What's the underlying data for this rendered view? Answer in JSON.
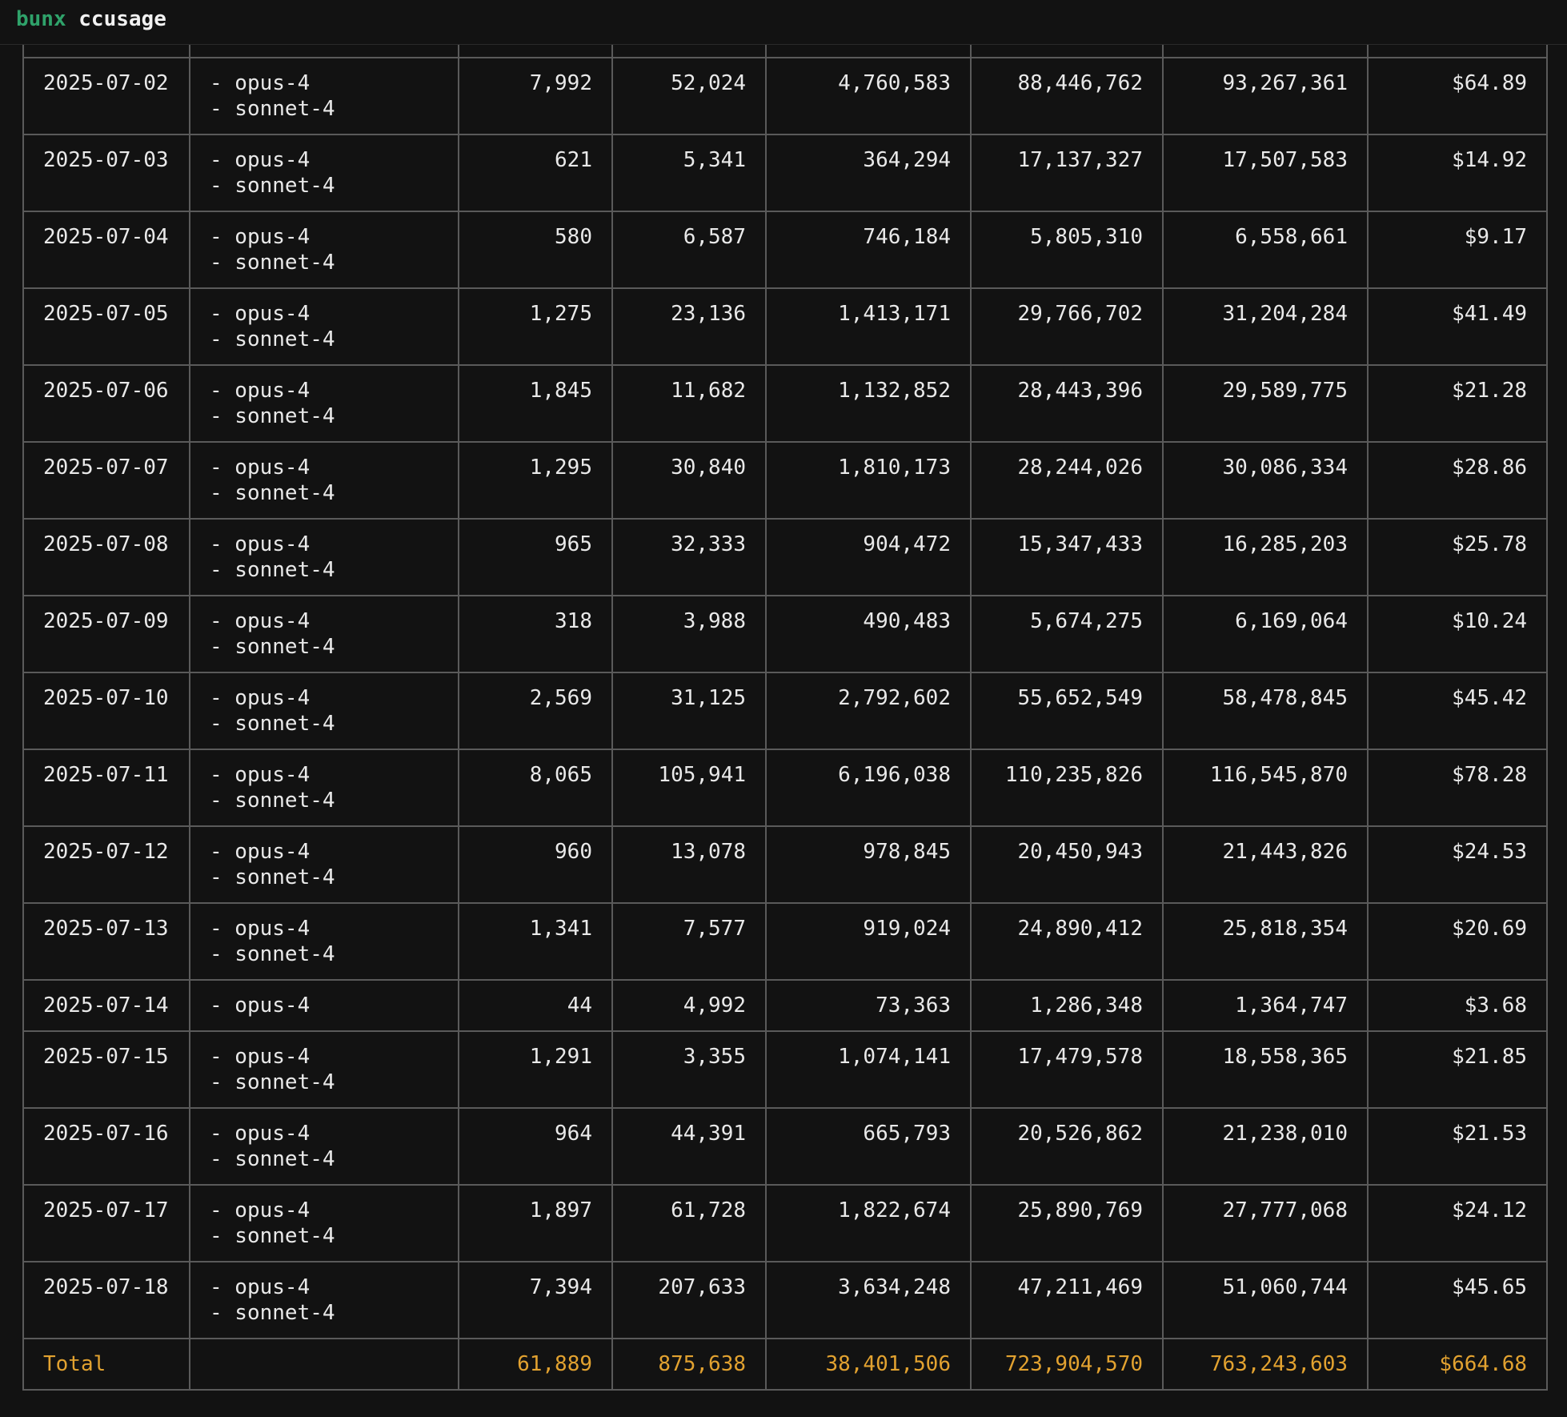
{
  "terminal": {
    "command_bin": "bunx",
    "command_arg": "ccusage"
  },
  "rows": [
    {
      "date": "2025-07-02",
      "models": [
        "- opus-4",
        "- sonnet-4"
      ],
      "input": "7,992",
      "output": "52,024",
      "cache_create": "4,760,583",
      "cache_read": "88,446,762",
      "total_tokens": "93,267,361",
      "cost": "$64.89"
    },
    {
      "date": "2025-07-03",
      "models": [
        "- opus-4",
        "- sonnet-4"
      ],
      "input": "621",
      "output": "5,341",
      "cache_create": "364,294",
      "cache_read": "17,137,327",
      "total_tokens": "17,507,583",
      "cost": "$14.92"
    },
    {
      "date": "2025-07-04",
      "models": [
        "- opus-4",
        "- sonnet-4"
      ],
      "input": "580",
      "output": "6,587",
      "cache_create": "746,184",
      "cache_read": "5,805,310",
      "total_tokens": "6,558,661",
      "cost": "$9.17"
    },
    {
      "date": "2025-07-05",
      "models": [
        "- opus-4",
        "- sonnet-4"
      ],
      "input": "1,275",
      "output": "23,136",
      "cache_create": "1,413,171",
      "cache_read": "29,766,702",
      "total_tokens": "31,204,284",
      "cost": "$41.49"
    },
    {
      "date": "2025-07-06",
      "models": [
        "- opus-4",
        "- sonnet-4"
      ],
      "input": "1,845",
      "output": "11,682",
      "cache_create": "1,132,852",
      "cache_read": "28,443,396",
      "total_tokens": "29,589,775",
      "cost": "$21.28"
    },
    {
      "date": "2025-07-07",
      "models": [
        "- opus-4",
        "- sonnet-4"
      ],
      "input": "1,295",
      "output": "30,840",
      "cache_create": "1,810,173",
      "cache_read": "28,244,026",
      "total_tokens": "30,086,334",
      "cost": "$28.86"
    },
    {
      "date": "2025-07-08",
      "models": [
        "- opus-4",
        "- sonnet-4"
      ],
      "input": "965",
      "output": "32,333",
      "cache_create": "904,472",
      "cache_read": "15,347,433",
      "total_tokens": "16,285,203",
      "cost": "$25.78"
    },
    {
      "date": "2025-07-09",
      "models": [
        "- opus-4",
        "- sonnet-4"
      ],
      "input": "318",
      "output": "3,988",
      "cache_create": "490,483",
      "cache_read": "5,674,275",
      "total_tokens": "6,169,064",
      "cost": "$10.24"
    },
    {
      "date": "2025-07-10",
      "models": [
        "- opus-4",
        "- sonnet-4"
      ],
      "input": "2,569",
      "output": "31,125",
      "cache_create": "2,792,602",
      "cache_read": "55,652,549",
      "total_tokens": "58,478,845",
      "cost": "$45.42"
    },
    {
      "date": "2025-07-11",
      "models": [
        "- opus-4",
        "- sonnet-4"
      ],
      "input": "8,065",
      "output": "105,941",
      "cache_create": "6,196,038",
      "cache_read": "110,235,826",
      "total_tokens": "116,545,870",
      "cost": "$78.28"
    },
    {
      "date": "2025-07-12",
      "models": [
        "- opus-4",
        "- sonnet-4"
      ],
      "input": "960",
      "output": "13,078",
      "cache_create": "978,845",
      "cache_read": "20,450,943",
      "total_tokens": "21,443,826",
      "cost": "$24.53"
    },
    {
      "date": "2025-07-13",
      "models": [
        "- opus-4",
        "- sonnet-4"
      ],
      "input": "1,341",
      "output": "7,577",
      "cache_create": "919,024",
      "cache_read": "24,890,412",
      "total_tokens": "25,818,354",
      "cost": "$20.69"
    },
    {
      "date": "2025-07-14",
      "models": [
        "- opus-4"
      ],
      "input": "44",
      "output": "4,992",
      "cache_create": "73,363",
      "cache_read": "1,286,348",
      "total_tokens": "1,364,747",
      "cost": "$3.68"
    },
    {
      "date": "2025-07-15",
      "models": [
        "- opus-4",
        "- sonnet-4"
      ],
      "input": "1,291",
      "output": "3,355",
      "cache_create": "1,074,141",
      "cache_read": "17,479,578",
      "total_tokens": "18,558,365",
      "cost": "$21.85"
    },
    {
      "date": "2025-07-16",
      "models": [
        "- opus-4",
        "- sonnet-4"
      ],
      "input": "964",
      "output": "44,391",
      "cache_create": "665,793",
      "cache_read": "20,526,862",
      "total_tokens": "21,238,010",
      "cost": "$21.53"
    },
    {
      "date": "2025-07-17",
      "models": [
        "- opus-4",
        "- sonnet-4"
      ],
      "input": "1,897",
      "output": "61,728",
      "cache_create": "1,822,674",
      "cache_read": "25,890,769",
      "total_tokens": "27,777,068",
      "cost": "$24.12"
    },
    {
      "date": "2025-07-18",
      "models": [
        "- opus-4",
        "- sonnet-4"
      ],
      "input": "7,394",
      "output": "207,633",
      "cache_create": "3,634,248",
      "cache_read": "47,211,469",
      "total_tokens": "51,060,744",
      "cost": "$45.65"
    }
  ],
  "total": {
    "label": "Total",
    "input": "61,889",
    "output": "875,638",
    "cache_create": "38,401,506",
    "cache_read": "723,904,570",
    "total_tokens": "763,243,603",
    "cost": "$664.68"
  },
  "colors": {
    "background": "#121212",
    "command": "#2fa26a",
    "total": "#e2a230",
    "border": "#5a5a5a"
  }
}
